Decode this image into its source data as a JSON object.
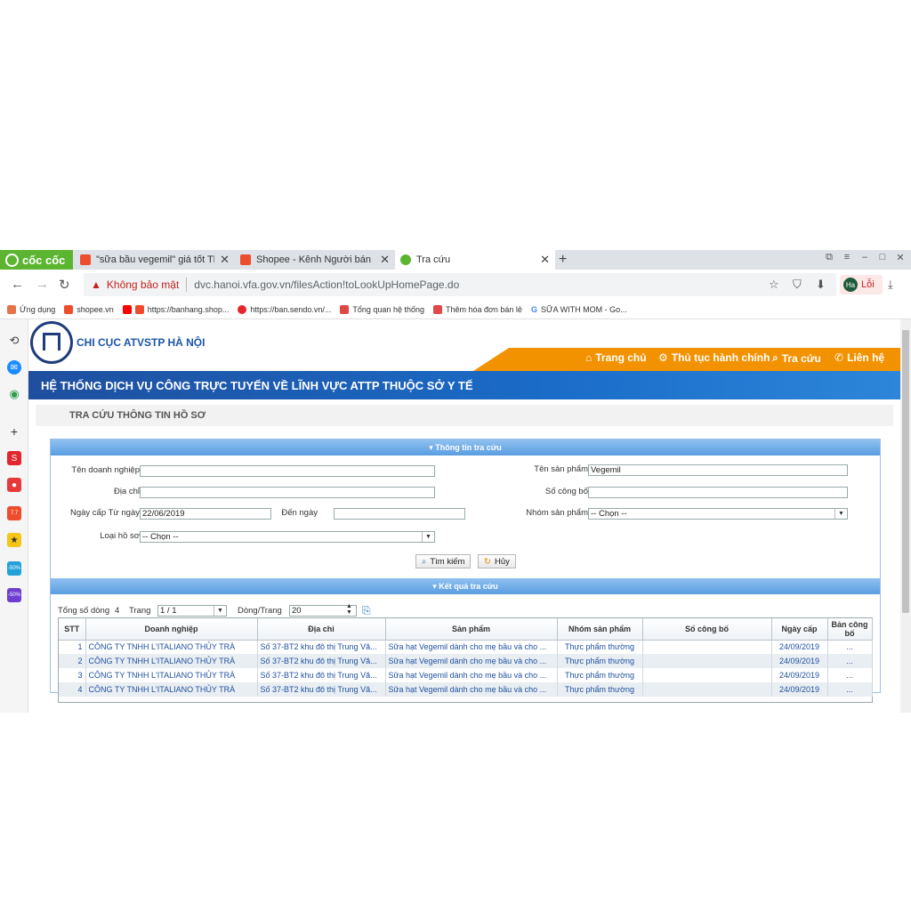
{
  "browser": {
    "brand": "cốc cốc",
    "tabs": [
      {
        "title": "\"sữa bầu vegemil\" giá tốt Tháng",
        "active": false
      },
      {
        "title": "Shopee - Kênh Người bán",
        "active": false
      },
      {
        "title": "Tra cứu",
        "active": true
      }
    ],
    "new_tab": "+",
    "not_secure": "Không bảo mật",
    "url": "dvc.hanoi.vfa.gov.vn/filesAction!toLookUpHomePage.do",
    "profile_initials": "Ha",
    "profile_status": "Lỗi",
    "bookmarks": [
      "Ứng dụng",
      "shopee.vn",
      "https://banhang.shop...",
      "https://ban.sendo.vn/...",
      "Tổng quan hệ thống",
      "Thêm hóa đơn bán lẻ",
      "SỮA WITH MOM - Go..."
    ]
  },
  "sidebar": {
    "badges": [
      "7.7",
      "-50%",
      "-50%"
    ]
  },
  "site": {
    "agency": "CHI CỤC ATVSTP HÀ NỘI",
    "nav": [
      "Trang chủ",
      "Thủ tục hành chính",
      "Tra cứu",
      "Liên hệ"
    ],
    "system_title": "HỆ THỐNG DỊCH VỤ CÔNG TRỰC TUYẾN VỀ LĨNH VỰC ATTP THUỘC SỞ Y TẾ",
    "page_heading": "TRA CỨU THÔNG TIN HỒ SƠ"
  },
  "search": {
    "header": "Thông tin tra cứu",
    "business_label": "Tên doanh nghiệp",
    "business_value": "",
    "address_label": "Địa chỉ",
    "address_value": "",
    "date_from_label": "Ngày cấp Từ ngày",
    "date_from_value": "22/06/2019",
    "date_to_label": "Đến ngày",
    "date_to_value": "",
    "doc_type_label": "Loại hồ sơ",
    "doc_type_value": "-- Chọn --",
    "product_label": "Tên sản phẩm",
    "product_value": "Vegemil",
    "announce_label": "Số công bố",
    "announce_value": "",
    "group_label": "Nhóm sản phẩm",
    "group_value": "-- Chọn --",
    "search_button": "Tìm kiếm",
    "cancel_button": "Hủy"
  },
  "results": {
    "header": "Kết quả tra cứu",
    "total_label": "Tổng số dòng",
    "total_value": "4",
    "page_label": "Trang",
    "page_value": "1 / 1",
    "rows_per_page_label": "Dòng/Trang",
    "rows_per_page_value": "20",
    "columns": [
      "STT",
      "Doanh nghiệp",
      "Địa chỉ",
      "Sản phẩm",
      "Nhóm sản phẩm",
      "Số công bố",
      "Ngày cấp",
      "Bản công bố"
    ],
    "rows": [
      [
        "1",
        "CÔNG TY TNHH L'ITALIANO THỦY TRÀ",
        "Số 37-BT2 khu đô thị Trung Vă...",
        "Sữa hạt Vegemil dành cho mẹ bầu và cho ...",
        "Thực phẩm thường",
        "",
        "24/09/2019",
        "..."
      ],
      [
        "2",
        "CÔNG TY TNHH L'ITALIANO THỦY TRÀ",
        "Số 37-BT2 khu đô thị Trung Vă...",
        "Sữa hạt Vegemil dành cho mẹ bầu và cho ...",
        "Thực phẩm thường",
        "",
        "24/09/2019",
        "..."
      ],
      [
        "3",
        "CÔNG TY TNHH L'ITALIANO THỦY TRÀ",
        "Số 37-BT2 khu đô thị Trung Vă...",
        "Sữa hạt Vegemil dành cho mẹ bầu và cho ...",
        "Thực phẩm thường",
        "",
        "24/09/2019",
        "..."
      ],
      [
        "4",
        "CÔNG TY TNHH L'ITALIANO THỦY TRÀ",
        "Số 37-BT2 khu đô thị Trung Vă...",
        "Sữa hạt Vegemil dành cho mẹ bầu và cho ...",
        "Thực phẩm thường",
        "",
        "24/09/2019",
        "..."
      ]
    ]
  },
  "colors": {
    "brand_green": "#5cb531",
    "site_orange": "#f39200",
    "site_blue": "#1a64b8",
    "section_header": "#5a9de0",
    "link_blue": "#1f4f9e"
  }
}
